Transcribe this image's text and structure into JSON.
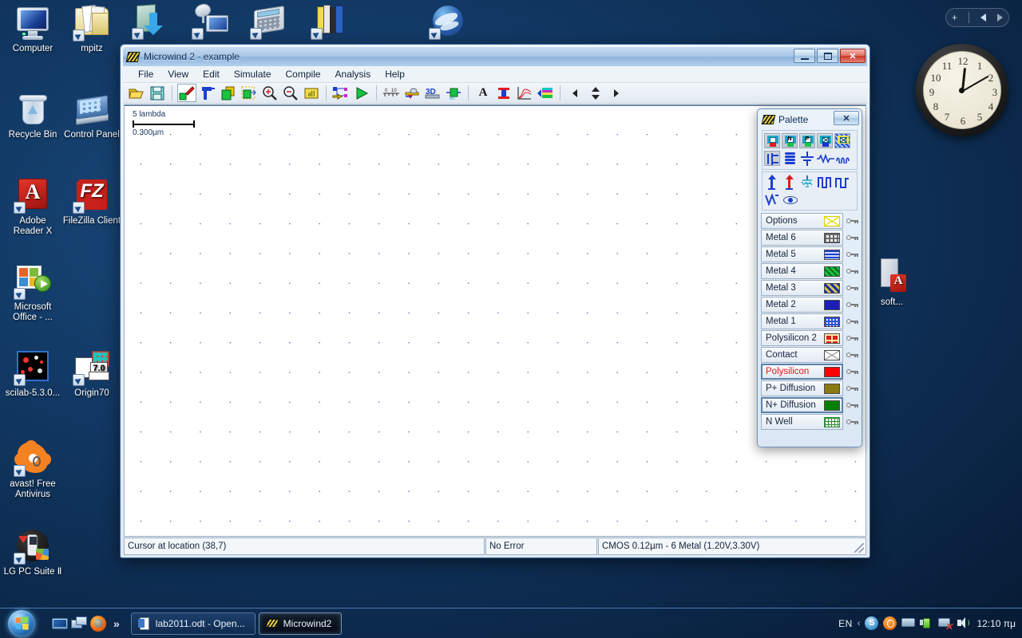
{
  "desktop": {
    "icons": [
      {
        "name": "Computer",
        "kind": "computer"
      },
      {
        "name": "mpitz",
        "kind": "folder"
      },
      {
        "name": "Recycle Bin",
        "kind": "bin"
      },
      {
        "name": "Control Panel",
        "kind": "control-panel"
      },
      {
        "name": "Adobe Reader X",
        "kind": "pdf"
      },
      {
        "name": "FileZilla Client",
        "kind": "filezilla"
      },
      {
        "name": "Microsoft Office - ...",
        "kind": "ms-office"
      },
      {
        "name": "scilab-5.3.0...",
        "kind": "scilab"
      },
      {
        "name": "Origin70",
        "kind": "origin"
      },
      {
        "name": "avast! Free Antivirus",
        "kind": "avast"
      },
      {
        "name": "LG PC Suite Ⅱ",
        "kind": "lg-pc-suite"
      },
      {
        "name": "",
        "kind": "download-folder"
      },
      {
        "name": "",
        "kind": "network-monitor"
      },
      {
        "name": "",
        "kind": "calculator"
      },
      {
        "name": "",
        "kind": "books"
      },
      {
        "name": "",
        "kind": "google-earth"
      },
      {
        "name": "soft...",
        "kind": "software-tower"
      }
    ]
  },
  "gadget": {
    "toolbar": {
      "add": "+",
      "prev": "◀",
      "next": "▶"
    },
    "clock": {
      "numerals": [
        "12",
        "1",
        "2",
        "3",
        "4",
        "5",
        "6",
        "7",
        "8",
        "9",
        "10",
        "11"
      ],
      "hour_angle_deg": 6,
      "minute_angle_deg": 60,
      "reads": "12:10"
    }
  },
  "window": {
    "title": "Microwind 2 - example",
    "buttons": {
      "minimize": "Minimize",
      "maximize": "Maximize",
      "close": "✕"
    },
    "menu": [
      "File",
      "View",
      "Edit",
      "Simulate",
      "Compile",
      "Analysis",
      "Help"
    ],
    "toolbar_groups": [
      {
        "items": [
          {
            "name": "open-icon",
            "label": "Open"
          },
          {
            "name": "save-icon",
            "label": "Save"
          }
        ]
      },
      {
        "items": [
          {
            "name": "draw-layout-icon",
            "label": "Draw layout",
            "selected": true
          },
          {
            "name": "delete-icon",
            "label": "Delete"
          },
          {
            "name": "copy-icon",
            "label": "Copy"
          },
          {
            "name": "stretch-icon",
            "label": "Stretch"
          },
          {
            "name": "zoom-in-icon",
            "label": "Zoom in"
          },
          {
            "name": "zoom-out-icon",
            "label": "Zoom out"
          },
          {
            "name": "view-all-icon",
            "label": "all"
          }
        ]
      },
      {
        "items": [
          {
            "name": "extract-netlist-icon",
            "label": "Extract"
          },
          {
            "name": "run-simulation-icon",
            "label": "Run simulation"
          }
        ]
      },
      {
        "items": [
          {
            "name": "measure-icon",
            "label": "Measure"
          },
          {
            "name": "cross-section-icon",
            "label": "Cross section"
          },
          {
            "name": "view-3d-icon",
            "label": "3D"
          },
          {
            "name": "process-icon",
            "label": "Process"
          }
        ]
      },
      {
        "items": [
          {
            "name": "text-icon",
            "label": "A"
          },
          {
            "name": "add-pad-icon",
            "label": "Add pad"
          },
          {
            "name": "waveform-icon",
            "label": "Waveforms"
          },
          {
            "name": "layer-stack-icon",
            "label": "Layer stack"
          }
        ]
      },
      {
        "items": [
          {
            "name": "nav-left-icon",
            "label": "Left"
          },
          {
            "name": "nav-updown-icon",
            "label": "Up/Down"
          },
          {
            "name": "nav-right-icon",
            "label": "Right"
          }
        ]
      }
    ],
    "canvas": {
      "scalebar": {
        "top_label": "5 lambda",
        "bottom_label": "0.300µm"
      }
    },
    "statusbar": {
      "cursor": "Cursor at location (38,7)",
      "error": "No Error",
      "technology": "CMOS 0.12µm - 6 Metal (1.20V,3.30V)"
    }
  },
  "palette": {
    "title": "Palette",
    "close_label": "✕",
    "device_row1": [
      {
        "name": "mos-device-icon",
        "label": "MOS device"
      },
      {
        "name": "nmos-device-icon",
        "label": "N"
      },
      {
        "name": "pmos-device-icon",
        "label": "P"
      },
      {
        "name": "contact-device-icon",
        "label": "X"
      },
      {
        "name": "pad-device-icon",
        "label": "Pad"
      }
    ],
    "device_row2": [
      {
        "name": "transistor-symbol-icon",
        "label": "Transistor"
      },
      {
        "name": "inductor-icon",
        "label": "Inductor"
      },
      {
        "name": "capacitor-icon",
        "label": "Capacitor"
      },
      {
        "name": "resistor-icon",
        "label": "Resistor"
      },
      {
        "name": "coil-icon",
        "label": "Coil"
      }
    ],
    "signal_row": [
      {
        "name": "vdd-icon",
        "label": "VDD"
      },
      {
        "name": "vss-icon",
        "label": "VSS"
      },
      {
        "name": "ground-icon",
        "label": "Ground"
      },
      {
        "name": "clock-signal-icon",
        "label": "Clock"
      },
      {
        "name": "pulse-signal-icon",
        "label": "Pulse"
      },
      {
        "name": "sine-signal-icon",
        "label": "Sinus"
      },
      {
        "name": "visible-signal-icon",
        "label": "Visible"
      }
    ],
    "layers": [
      {
        "label": "Options",
        "swatch": "options",
        "color": "#ffff00",
        "active": false,
        "locked": true
      },
      {
        "label": "Metal 6",
        "swatch": "metal6",
        "color": "#ffffff",
        "active": false,
        "locked": true
      },
      {
        "label": "Metal 5",
        "swatch": "metal5",
        "color": "#1b3fd0",
        "active": false,
        "locked": true
      },
      {
        "label": "Metal 4",
        "swatch": "metal4",
        "color": "#18c23e",
        "active": false,
        "locked": true
      },
      {
        "label": "Metal 3",
        "swatch": "metal3",
        "color": "#d9c84a",
        "active": false,
        "locked": true
      },
      {
        "label": "Metal 2",
        "swatch": "metal2",
        "color": "#1b1fb8",
        "active": false,
        "locked": true
      },
      {
        "label": "Metal 1",
        "swatch": "metal1",
        "color": "#2a4fd8",
        "active": false,
        "locked": true
      },
      {
        "label": "Polysilicon 2",
        "swatch": "poly2",
        "color": "#e01b1b",
        "active": false,
        "locked": true
      },
      {
        "label": "Contact",
        "swatch": "contact",
        "color": "#ffffff",
        "active": false,
        "locked": true
      },
      {
        "label": "Polysilicon",
        "swatch": "poly",
        "color": "#ff0000",
        "active": true,
        "locked": true
      },
      {
        "label": "P+ Diffusion",
        "swatch": "pdiff",
        "color": "#8a7a12",
        "active": false,
        "locked": true
      },
      {
        "label": "N+ Diffusion",
        "swatch": "ndiff",
        "color": "#008000",
        "active": true,
        "locked": true
      },
      {
        "label": "N Well",
        "swatch": "nwell",
        "color": "#2f8b3a",
        "active": false,
        "locked": true
      }
    ]
  },
  "taskbar": {
    "start_label": "Start",
    "quicklaunch": [
      {
        "name": "show-desktop-icon",
        "label": "Show desktop"
      },
      {
        "name": "switch-windows-icon",
        "label": "Switch between windows"
      },
      {
        "name": "firefox-icon",
        "label": "Mozilla Firefox"
      }
    ],
    "more_label": "»",
    "tasks": [
      {
        "label": "lab2011.odt - Open...",
        "icon": "writer-icon",
        "active": false
      },
      {
        "label": "Microwind2",
        "icon": "microwind-icon",
        "active": true
      }
    ],
    "tray": {
      "language": "EN",
      "chevron": "‹",
      "icons": [
        {
          "name": "skype-tray-icon",
          "label": "Skype"
        },
        {
          "name": "avast-tray-icon",
          "label": "avast!"
        },
        {
          "name": "display-tray-icon",
          "label": "Display"
        },
        {
          "name": "power-tray-icon",
          "label": "Power"
        },
        {
          "name": "network-tray-icon",
          "label": "Network (disconnected)"
        },
        {
          "name": "volume-tray-icon",
          "label": "Volume"
        }
      ],
      "clock": "12:10 πμ"
    }
  }
}
